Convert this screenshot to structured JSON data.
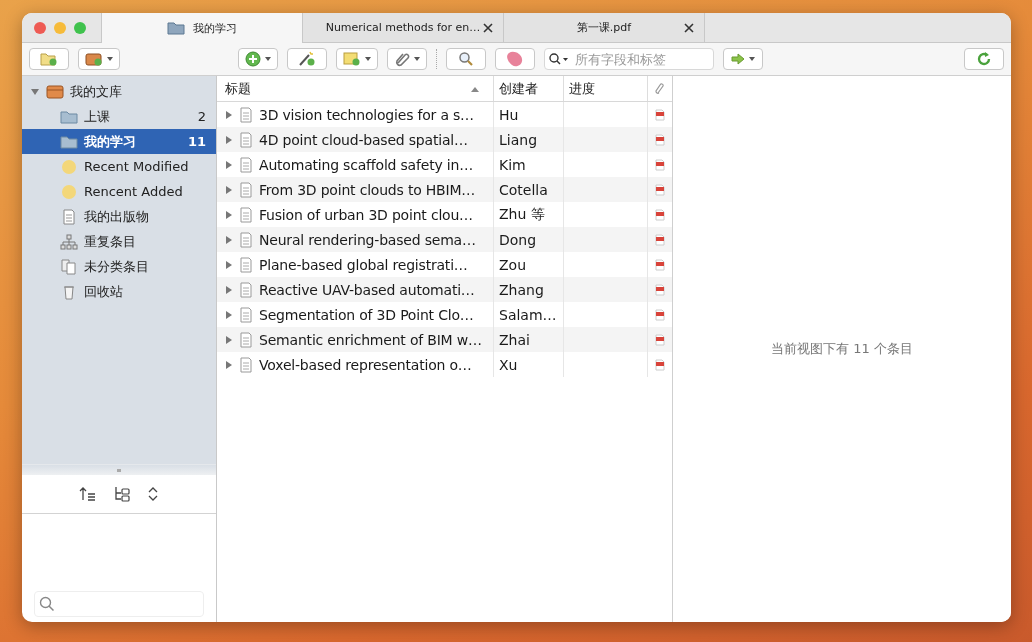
{
  "tabs": [
    {
      "label": "我的学习",
      "kind": "library",
      "selected": true
    },
    {
      "label": "Numerical methods for en…",
      "kind": "document",
      "selected": false
    },
    {
      "label": "第一课.pdf",
      "kind": "document",
      "selected": false
    }
  ],
  "search": {
    "placeholder": "所有字段和标签"
  },
  "sidebar": {
    "root": {
      "label": "我的文库",
      "expanded": true
    },
    "items": [
      {
        "label": "上课",
        "kind": "folder",
        "count": "2",
        "selected": false
      },
      {
        "label": "我的学习",
        "kind": "folder",
        "count": "11",
        "selected": true
      },
      {
        "label": "Recent Modified",
        "kind": "saved-search",
        "selected": false
      },
      {
        "label": "Rencent Added",
        "kind": "saved-search",
        "selected": false
      },
      {
        "label": "我的出版物",
        "kind": "publications",
        "selected": false
      },
      {
        "label": "重复条目",
        "kind": "duplicates",
        "selected": false
      },
      {
        "label": "未分类条目",
        "kind": "unfiled",
        "selected": false
      },
      {
        "label": "回收站",
        "kind": "trash",
        "selected": false
      }
    ]
  },
  "table": {
    "columns": [
      "标题",
      "创建者",
      "进度"
    ],
    "rows": [
      {
        "title": "3D vision technologies for a s…",
        "creator": "Hu"
      },
      {
        "title": "4D point cloud-based spatial…",
        "creator": "Liang"
      },
      {
        "title": "Automating scaffold safety in…",
        "creator": "Kim"
      },
      {
        "title": "From 3D point clouds to HBIM…",
        "creator": "Cotella"
      },
      {
        "title": "Fusion of urban 3D point clou…",
        "creator": "Zhu 等"
      },
      {
        "title": "Neural rendering-based sema…",
        "creator": "Dong"
      },
      {
        "title": "Plane-based global registrati…",
        "creator": "Zou"
      },
      {
        "title": "Reactive UAV-based automati…",
        "creator": "Zhang"
      },
      {
        "title": "Segmentation of 3D Point Clo…",
        "creator": "Salam…"
      },
      {
        "title": "Semantic enrichment of BIM w…",
        "creator": "Zhai"
      },
      {
        "title": "Voxel-based representation o…",
        "creator": "Xu"
      }
    ]
  },
  "item_pane": {
    "message": "当前视图下有 11 个条目"
  }
}
